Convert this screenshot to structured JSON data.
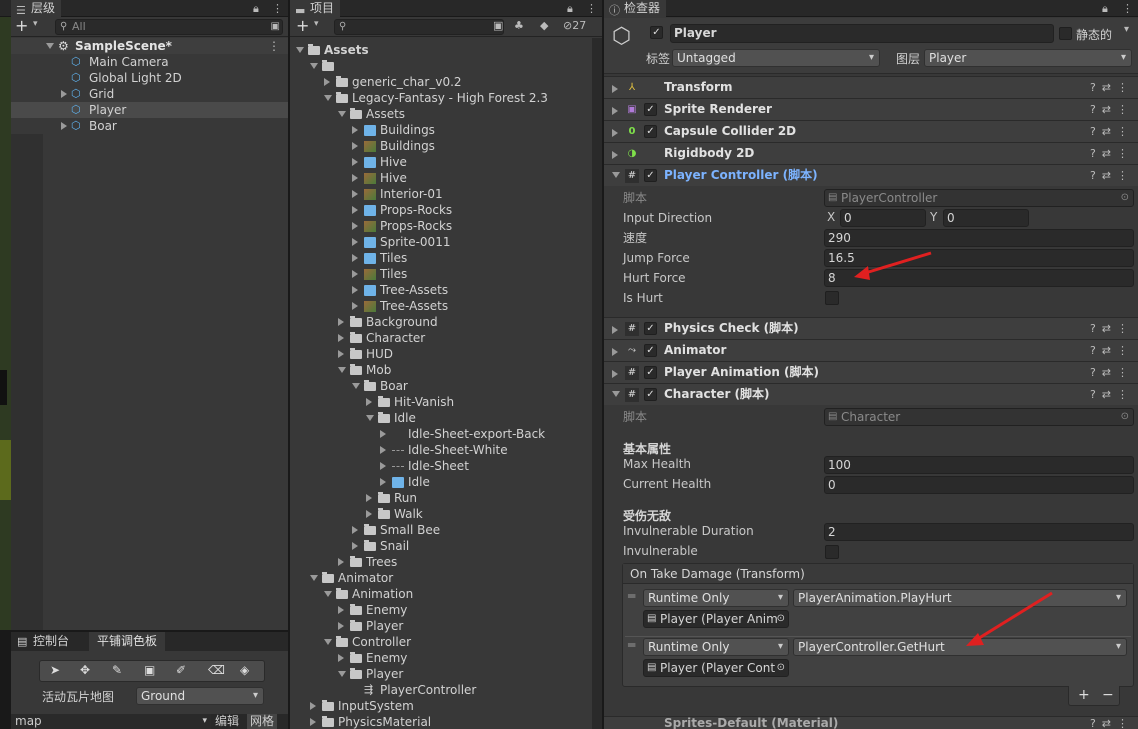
{
  "hierarchy": {
    "tab": "层级",
    "search_placeholder": "All",
    "scene": "SampleScene*",
    "items": [
      "Main Camera",
      "Global Light 2D",
      "Grid",
      "Player",
      "Boar"
    ]
  },
  "tile_palette": {
    "tabs": [
      "控制台",
      "平铺调色板"
    ],
    "active_map_label": "活动瓦片地图",
    "active_map_value": "Ground",
    "bottom_field": "map",
    "edit_label": "编辑",
    "grid_label": "网格"
  },
  "project": {
    "tab": "项目",
    "badge_count": "27",
    "tree": [
      {
        "d": 0,
        "t": "folder",
        "open": true,
        "label": "Assets",
        "bold": true
      },
      {
        "d": 1,
        "t": "folder",
        "open": true,
        "label": ""
      },
      {
        "d": 2,
        "t": "folder",
        "open": false,
        "label": "generic_char_v0.2"
      },
      {
        "d": 2,
        "t": "folder",
        "open": true,
        "label": "Legacy-Fantasy - High Forest 2.3"
      },
      {
        "d": 3,
        "t": "folder",
        "open": true,
        "label": "Assets"
      },
      {
        "d": 4,
        "t": "prefab",
        "open": false,
        "label": "Buildings"
      },
      {
        "d": 4,
        "t": "sprite",
        "open": false,
        "label": "Buildings"
      },
      {
        "d": 4,
        "t": "prefab",
        "open": false,
        "label": "Hive"
      },
      {
        "d": 4,
        "t": "sprite",
        "open": false,
        "label": "Hive"
      },
      {
        "d": 4,
        "t": "sprite",
        "open": false,
        "label": "Interior-01"
      },
      {
        "d": 4,
        "t": "prefab",
        "open": false,
        "label": "Props-Rocks"
      },
      {
        "d": 4,
        "t": "sprite",
        "open": false,
        "label": "Props-Rocks"
      },
      {
        "d": 4,
        "t": "prefab",
        "open": false,
        "label": "Sprite-0011"
      },
      {
        "d": 4,
        "t": "prefab",
        "open": false,
        "label": "Tiles"
      },
      {
        "d": 4,
        "t": "sprite",
        "open": false,
        "label": "Tiles"
      },
      {
        "d": 4,
        "t": "prefab",
        "open": false,
        "label": "Tree-Assets"
      },
      {
        "d": 4,
        "t": "sprite",
        "open": false,
        "label": "Tree-Assets"
      },
      {
        "d": 3,
        "t": "folder",
        "open": false,
        "label": "Background"
      },
      {
        "d": 3,
        "t": "folder",
        "open": false,
        "label": "Character"
      },
      {
        "d": 3,
        "t": "folder",
        "open": false,
        "label": "HUD"
      },
      {
        "d": 3,
        "t": "folder",
        "open": true,
        "label": "Mob"
      },
      {
        "d": 4,
        "t": "folder",
        "open": true,
        "label": "Boar"
      },
      {
        "d": 5,
        "t": "folder",
        "open": false,
        "label": "Hit-Vanish"
      },
      {
        "d": 5,
        "t": "folder",
        "open": true,
        "label": "Idle"
      },
      {
        "d": 6,
        "t": "none",
        "open": false,
        "label": "Idle-Sheet-export-Back"
      },
      {
        "d": 6,
        "t": "dots",
        "open": false,
        "label": "Idle-Sheet-White"
      },
      {
        "d": 6,
        "t": "dots",
        "open": false,
        "label": "Idle-Sheet"
      },
      {
        "d": 6,
        "t": "prefab",
        "open": false,
        "label": "Idle"
      },
      {
        "d": 5,
        "t": "folder",
        "open": false,
        "label": "Run"
      },
      {
        "d": 5,
        "t": "folder",
        "open": false,
        "label": "Walk"
      },
      {
        "d": 4,
        "t": "folder",
        "open": false,
        "label": "Small Bee"
      },
      {
        "d": 4,
        "t": "folder",
        "open": false,
        "label": "Snail"
      },
      {
        "d": 3,
        "t": "folder",
        "open": false,
        "label": "Trees"
      },
      {
        "d": 1,
        "t": "folder",
        "open": true,
        "label": "Animator"
      },
      {
        "d": 2,
        "t": "folder",
        "open": true,
        "label": "Animation"
      },
      {
        "d": 3,
        "t": "folder",
        "open": false,
        "label": "Enemy"
      },
      {
        "d": 3,
        "t": "folder",
        "open": false,
        "label": "Player"
      },
      {
        "d": 2,
        "t": "folder",
        "open": true,
        "label": "Controller"
      },
      {
        "d": 3,
        "t": "folder",
        "open": false,
        "label": "Enemy"
      },
      {
        "d": 3,
        "t": "folder",
        "open": true,
        "label": "Player"
      },
      {
        "d": 4,
        "t": "ctrl",
        "open": false,
        "label": "PlayerController",
        "noarrow": true
      },
      {
        "d": 1,
        "t": "folder",
        "open": false,
        "label": "InputSystem"
      },
      {
        "d": 1,
        "t": "folder",
        "open": false,
        "label": "PhysicsMaterial"
      }
    ]
  },
  "inspector": {
    "tab": "检查器",
    "object_name": "Player",
    "static_label": "静态的",
    "tag_label": "标签",
    "tag_value": "Untagged",
    "layer_label": "图层",
    "layer_value": "Player",
    "components": {
      "transform": "Transform",
      "sprite_renderer": "Sprite Renderer",
      "capsule": "Capsule Collider 2D",
      "rigidbody": "Rigidbody 2D",
      "player_controller": "Player Controller  (脚本)",
      "physics_check": "Physics Check  (脚本)",
      "animator": "Animator",
      "player_animation": "Player Animation  (脚本)",
      "character": "Character  (脚本)",
      "bottom": "Sprites-Default (Material)"
    },
    "pc": {
      "script_label": "脚本",
      "script_value": "PlayerController",
      "input_direction": "Input Direction",
      "x_label": "X",
      "x_value": "0",
      "y_label": "Y",
      "y_value": "0",
      "speed_label": "速度",
      "speed_value": "290",
      "jump_label": "Jump Force",
      "jump_value": "16.5",
      "hurt_label": "Hurt Force",
      "hurt_value": "8",
      "ishurt_label": "Is Hurt"
    },
    "ch": {
      "script_label": "脚本",
      "script_value": "Character",
      "basic_section": "基本属性",
      "max_health_label": "Max Health",
      "max_health_value": "100",
      "cur_health_label": "Current Health",
      "cur_health_value": "0",
      "invuln_section": "受伤无敌",
      "inv_dur_label": "Invulnerable Duration",
      "inv_dur_value": "2",
      "inv_label": "Invulnerable",
      "event_title": "On Take Damage (Transform)",
      "events": [
        {
          "mode": "Runtime Only",
          "func": "PlayerAnimation.PlayHurt",
          "target": "Player (Player Anim"
        },
        {
          "mode": "Runtime Only",
          "func": "PlayerController.GetHurt",
          "target": "Player (Player Cont"
        }
      ],
      "add": "+",
      "remove": "−"
    }
  },
  "colors": {
    "accent": "#7cb3ff",
    "arrow": "#e02020",
    "selected": "#4a4a4a",
    "panel": "#383838"
  }
}
